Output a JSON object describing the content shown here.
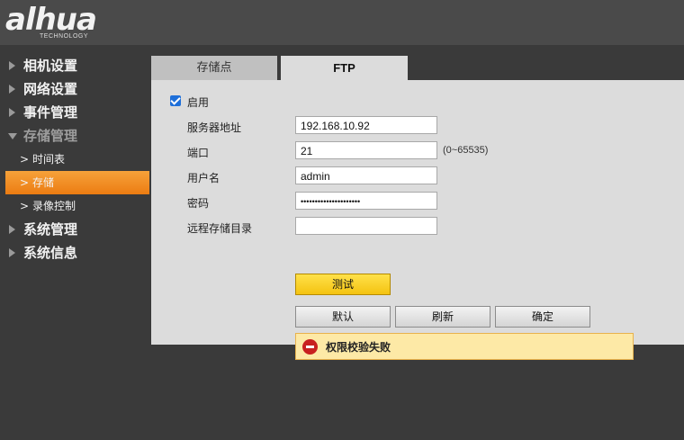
{
  "brand": {
    "logo": "alhua",
    "tagline": "TECHNOLOGY"
  },
  "sidebar": {
    "items": [
      {
        "label": "相机设置"
      },
      {
        "label": "网络设置"
      },
      {
        "label": "事件管理"
      },
      {
        "label": "存储管理"
      },
      {
        "label": "系统管理"
      },
      {
        "label": "系统信息"
      }
    ],
    "sub_items": [
      {
        "label": "时间表"
      },
      {
        "label": "存储"
      },
      {
        "label": "录像控制"
      }
    ],
    "chevron": ">"
  },
  "tabs": [
    {
      "label": "存储点"
    },
    {
      "label": "FTP"
    }
  ],
  "form": {
    "enable_label": "启用",
    "server_label": "服务器地址",
    "server_value": "192.168.10.92",
    "port_label": "端口",
    "port_value": "21",
    "port_hint": "(0~65535)",
    "user_label": "用户名",
    "user_value": "admin",
    "password_label": "密码",
    "password_value": "•••••••••••••••••••••",
    "remote_dir_label": "远程存储目录",
    "remote_dir_value": ""
  },
  "buttons": {
    "test": "测试",
    "default": "默认",
    "refresh": "刷新",
    "confirm": "确定"
  },
  "alert": {
    "text": "权限校验失败"
  }
}
